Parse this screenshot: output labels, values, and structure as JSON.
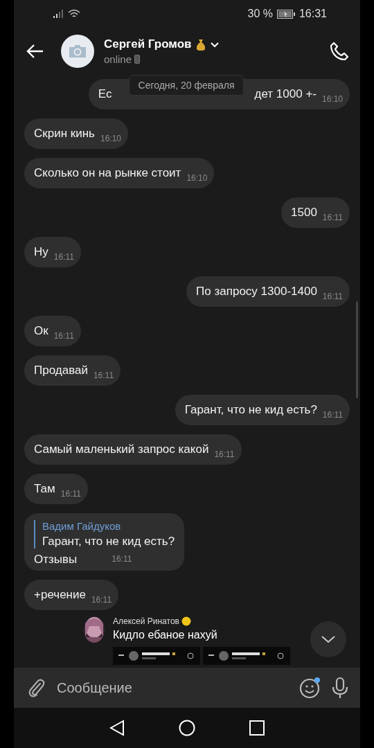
{
  "status_bar": {
    "battery": "30 %",
    "time": "16:31"
  },
  "header": {
    "name": "Сергей Громов",
    "status": "online"
  },
  "date_badge": "Сегодня, 20 февраля",
  "messages": [
    {
      "kind": "out",
      "text_parts": [
        "Ес",
        "дет 1000 +-"
      ],
      "time": "16:10"
    },
    {
      "kind": "in",
      "text": "Скрин кинь",
      "time": "16:10"
    },
    {
      "kind": "in",
      "text": "Сколько он на рынке стоит",
      "time": "16:10"
    },
    {
      "kind": "out",
      "text": "1500",
      "time": "16:11"
    },
    {
      "kind": "in",
      "text": "Ну",
      "time": "16:11"
    },
    {
      "kind": "out",
      "text": "По запросу 1300-1400",
      "time": "16:11"
    },
    {
      "kind": "in",
      "text": "Ок",
      "time": "16:11"
    },
    {
      "kind": "in",
      "text": "Продавай",
      "time": "16:11"
    },
    {
      "kind": "out",
      "text": "Гарант, что не кид есть?",
      "time": "16:11"
    },
    {
      "kind": "in",
      "text": "Самый маленький запрос какой",
      "time": "16:11"
    },
    {
      "kind": "in",
      "text": "Там",
      "time": "16:11"
    },
    {
      "kind": "reply",
      "quote_author": "Вадим Гайдуков",
      "quote_text": "Гарант, что не кид есть?",
      "text": "Отзывы",
      "time": "16:11"
    },
    {
      "kind": "in",
      "text": "+речение",
      "time": "16:11"
    },
    {
      "kind": "forward",
      "author": "Алексей Ринатов",
      "text": "Кидло ебаное нахуй"
    }
  ],
  "composer": {
    "placeholder": "Сообщение"
  }
}
